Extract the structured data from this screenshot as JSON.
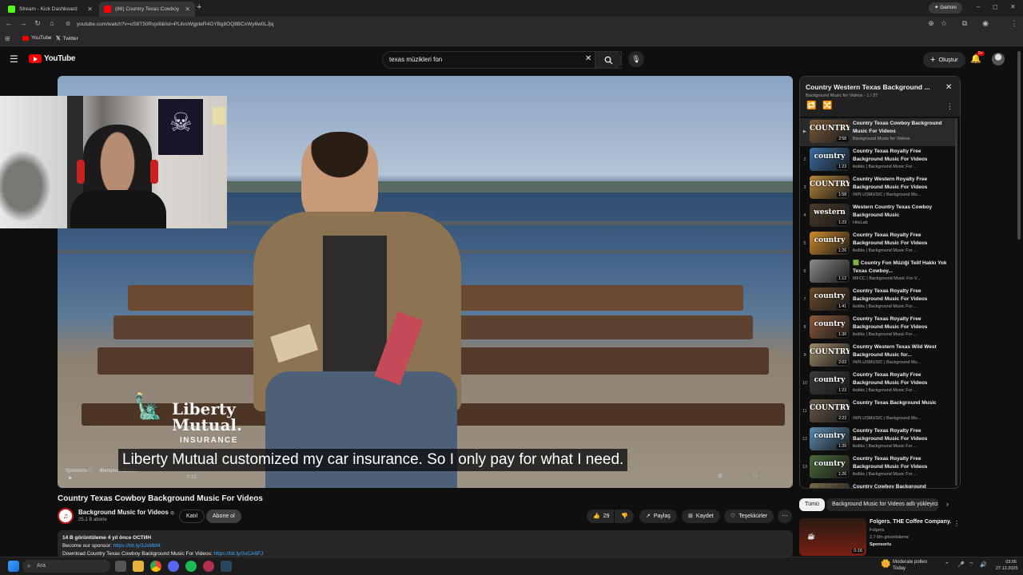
{
  "browser": {
    "tabs": [
      {
        "label": "Stream - Kick Dashboard",
        "favicon_color": "#53fc18"
      },
      {
        "label": "(86) Country Texas Cowboy",
        "favicon_color": "#ff0000"
      }
    ],
    "url": "youtube.com/watch?v=oS8T50Rsjv8&list=PLilvsWgpteR4GYBg8OQ8BCxWy6w0LJjq",
    "gemini_label": "Gemini",
    "bookmarks": [
      {
        "label": "YouTube"
      },
      {
        "label": "Twitter"
      }
    ]
  },
  "youtube": {
    "logo_text": "YouTube",
    "search_value": "texas müzikleri fon",
    "create_label": "Oluştur",
    "notif_badge": "9+",
    "accent": "#ff0000"
  },
  "video": {
    "caption": "Liberty Mutual customized my car insurance. So I only pay for what I need.",
    "ad_brand_line1": "Liberty",
    "ad_brand_line2": "Mutual.",
    "ad_brand_line3": "INSURANCE",
    "sponsored": "Sponsorlu",
    "ad_domain": "libertymutual.com",
    "time": "0:15"
  },
  "watch": {
    "title": "Country Texas Cowboy Background Music For Videos",
    "channel_name": "Background Music for Videos",
    "subscribers": "25,1 B abone",
    "join_label": "Katıl",
    "subscribe_label": "Abone ol",
    "likes": "29",
    "share_label": "Paylaş",
    "save_label": "Kaydet",
    "thanks_label": "Teşekkürler",
    "views_line": "14 B görüntüleme  4 yıl önce  ОСТИН",
    "desc_line1_prefix": "Become our sponsor: ",
    "desc_line1_link": "https://bit.ly/3JsMbf4",
    "desc_line2_prefix": "Download Country Texas Cowboy Background Music For Videos: ",
    "desc_line2_link": "https://bit.ly/3oCA6FJ"
  },
  "playlist": {
    "title": "Country Western Texas Background ...",
    "subtitle": "Background Music for Videos - 1 / 37",
    "items": [
      {
        "idx": "▶",
        "title": "Country Texas Cowboy Background Music For Videos",
        "channel": "Background Music for Videos",
        "dur": "2:58",
        "word": "COUNTRY",
        "color": "#7a5a3a"
      },
      {
        "idx": "2",
        "title": "Country Texas Royalty Free Background Music For Videos",
        "channel": "ikoliks | Background Music For ...",
        "dur": "1:23",
        "word": "country",
        "color": "#3a6ea5"
      },
      {
        "idx": "3",
        "title": "Country Western Royalty Free Background Music For Videos",
        "channel": "INPLUSMUSIC | Background Mu...",
        "dur": "1:58",
        "word": "COUNTRY",
        "color": "#b8863a"
      },
      {
        "idx": "4",
        "title": "Western Country Texas Cowboy Background Music",
        "channel": "HitsLab",
        "dur": "1:23",
        "word": "western",
        "color": "#4a3a2a"
      },
      {
        "idx": "5",
        "title": "Country Texas Royalty Free Background Music For Videos",
        "channel": "ikoliks | Background Music For ...",
        "dur": "1:26",
        "word": "country",
        "color": "#d08a2a"
      },
      {
        "idx": "6",
        "title": "🟩 Country Fon Müziği Telif Hakkı Yok Texas Cowboy...",
        "channel": "MFCC | Background Music For V...",
        "dur": "1:12",
        "word": "",
        "color": "#8a8a8a"
      },
      {
        "idx": "7",
        "title": "Country Texas Royalty Free Background Music For Videos",
        "channel": "ikoliks | Background Music For ...",
        "dur": "1:41",
        "word": "country",
        "color": "#6a4a2a"
      },
      {
        "idx": "8",
        "title": "Country Texas Royalty Free Background Music For Videos",
        "channel": "ikoliks | Background Music For ...",
        "dur": "1:30",
        "word": "country",
        "color": "#8a5a3a"
      },
      {
        "idx": "9",
        "title": "Country Western Texas Wild West Background Music for...",
        "channel": "INPLUSMUSIC | Background Mu...",
        "dur": "2:03",
        "word": "COUNTRY",
        "color": "#a08a6a"
      },
      {
        "idx": "10",
        "title": "Country Texas Royalty Free Background Music For Videos",
        "channel": "ikoliks | Background Music For ...",
        "dur": "1:23",
        "word": "country",
        "color": "#3a3a3a"
      },
      {
        "idx": "11",
        "title": "Country Texas Background Music",
        "channel": "INPLUSMUSIC | Background Mu...",
        "dur": "2:23",
        "word": "COUNTRY",
        "color": "#6a5a4a"
      },
      {
        "idx": "12",
        "title": "Country Texas Royalty Free Background Music For Videos",
        "channel": "ikoliks | Background Music For ...",
        "dur": "1:20",
        "word": "country",
        "color": "#5a8ab0"
      },
      {
        "idx": "13",
        "title": "Country Texas Royalty Free Background Music For Videos",
        "channel": "ikoliks | Background Music For ...",
        "dur": "1:26",
        "word": "country",
        "color": "#4a6a3a"
      },
      {
        "idx": "",
        "title": "Country Cowboy Background",
        "channel": "",
        "dur": "",
        "word": "",
        "color": "#7a6a4a"
      }
    ]
  },
  "chips": {
    "all": "Tümü",
    "second": "Background Music for Videos adlı yükleyici"
  },
  "ad_card": {
    "title": "Folgers. THE Coffee Company.",
    "channel": "Folgers",
    "views": "2,7 Mn görüntüleme",
    "sponsored": "Sponsorlu",
    "dur": "0:16"
  },
  "taskbar": {
    "search_placeholder": "Ara",
    "weather_line1": "Moderate pollen",
    "weather_line2": "Today",
    "clock": "03:05",
    "date": "27.12.2025"
  }
}
